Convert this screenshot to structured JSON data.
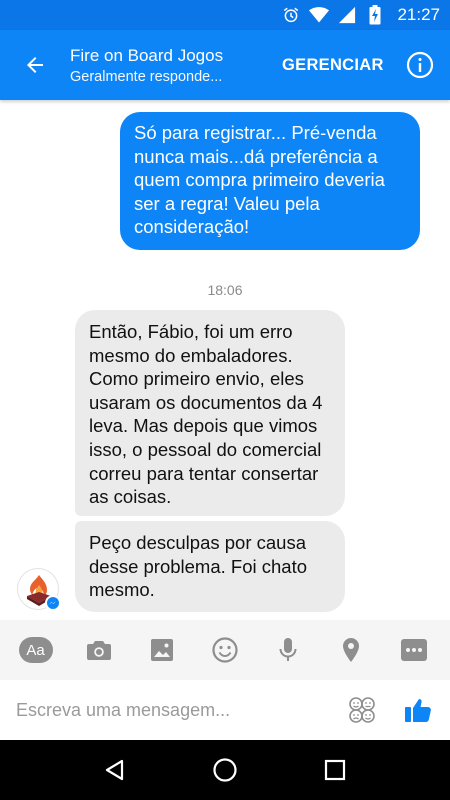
{
  "status_bar": {
    "time": "21:27",
    "icons": [
      "alarm-icon",
      "wifi-icon",
      "signal-icon",
      "battery-charging-icon"
    ]
  },
  "header": {
    "title": "Fire on Board Jogos",
    "subtitle": "Geralmente responde...",
    "manage_label": "GERENCIAR",
    "back_icon": "arrow-left-icon",
    "info_icon": "info-icon"
  },
  "conversation": {
    "outgoing": [
      {
        "text": "Só para registrar... Pré-venda nunca mais...dá preferência a quem compra primeiro deveria ser a regra! Valeu pela consideração!"
      }
    ],
    "timestamp": "18:06",
    "incoming": [
      {
        "text": "Então, Fábio, foi um erro mesmo do embaladores. Como primeiro envio, eles usaram os documentos da 4 leva. Mas depois que vimos isso, o pessoal do comercial correu para tentar consertar as coisas."
      },
      {
        "text": "Peço desculpas por causa desse problema. Foi chato mesmo."
      }
    ]
  },
  "composer": {
    "aa_label": "Aa",
    "tools": [
      "camera-icon",
      "image-icon",
      "smiley-icon",
      "mic-icon",
      "location-pin-icon",
      "more-icon"
    ],
    "input_placeholder": "Escreva uma mensagem...",
    "emoji_icon": "emoji-faces-icon",
    "like_icon": "thumbs-up-icon"
  },
  "nav": {
    "icons": [
      "back-triangle-icon",
      "home-circle-icon",
      "recents-square-icon"
    ]
  },
  "colors": {
    "brand_blue": "#0e85f7",
    "status_blue": "#0b76e8",
    "incoming_bubble": "#ebebeb",
    "toolbar_bg": "#f5f5f5"
  }
}
